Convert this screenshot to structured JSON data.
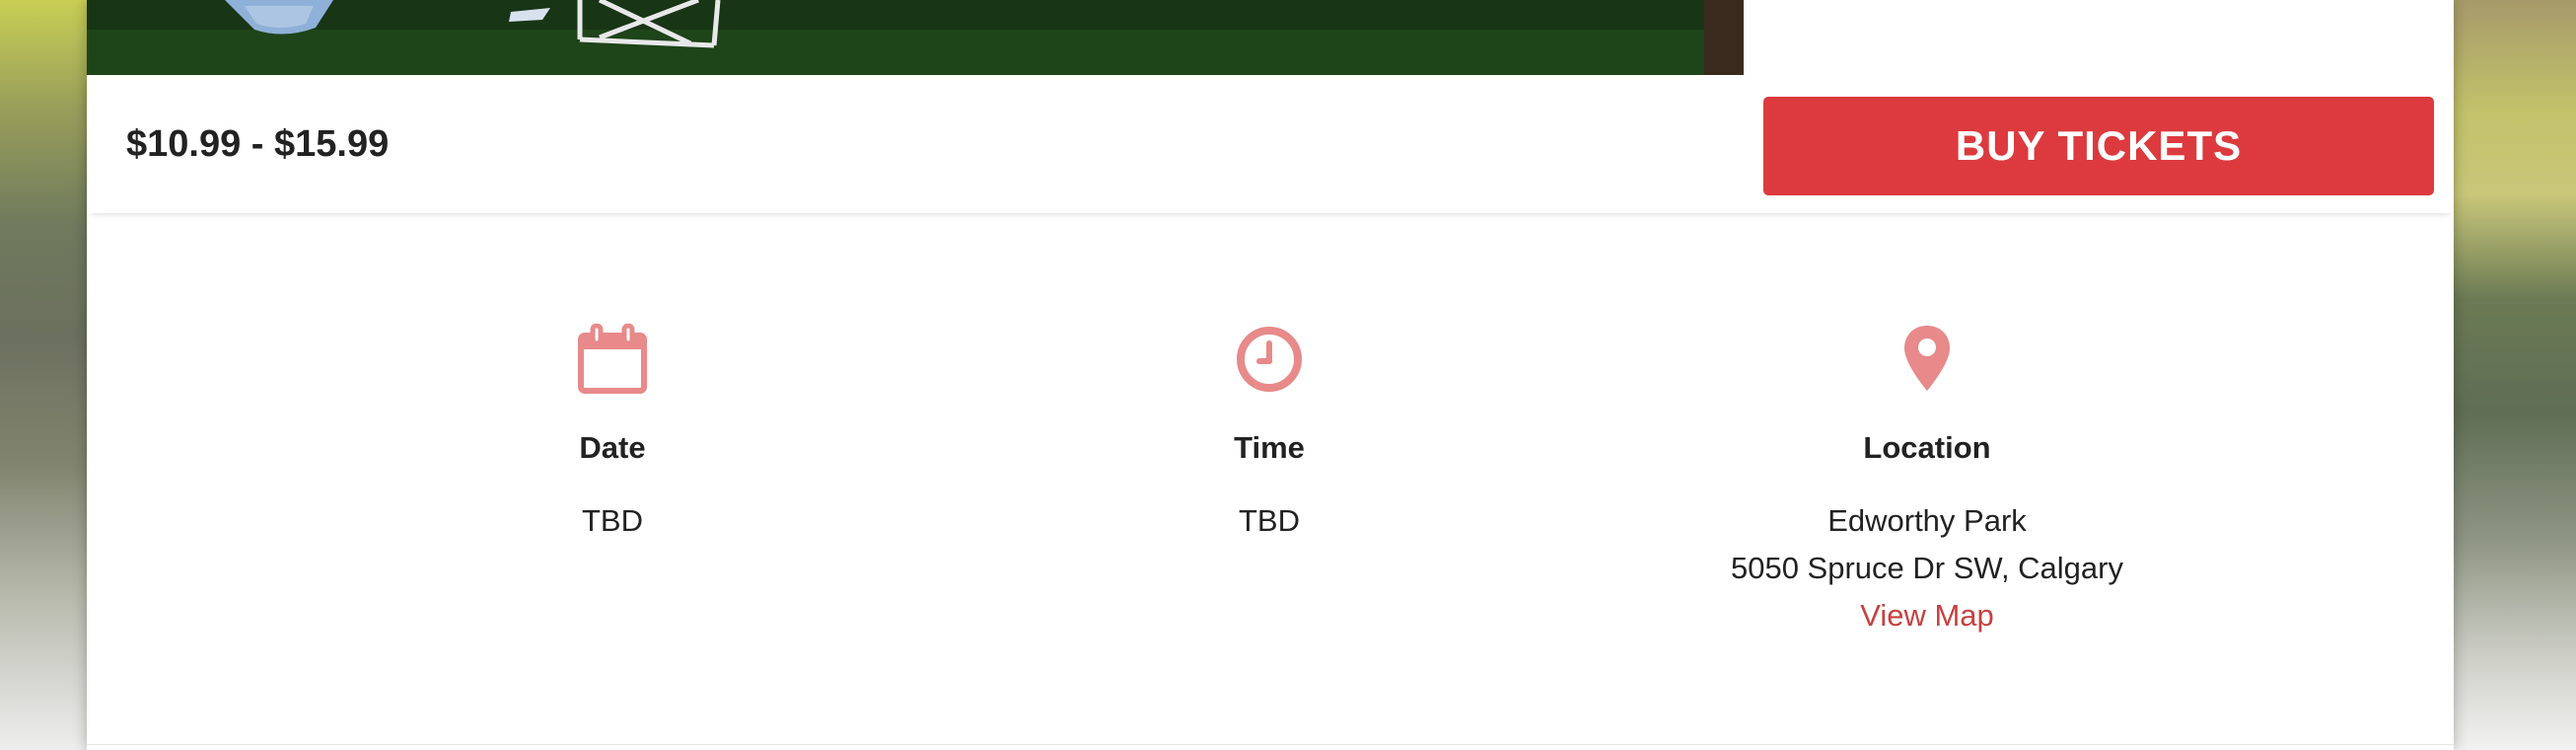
{
  "event": {
    "price_range": "$10.99 - $15.99",
    "buy_label": "BUY TICKETS"
  },
  "details": {
    "date": {
      "icon": "calendar-icon",
      "label": "Date",
      "value": "TBD"
    },
    "time": {
      "icon": "clock-icon",
      "label": "Time",
      "value": "TBD"
    },
    "location": {
      "icon": "map-pin-icon",
      "label": "Location",
      "venue": "Edworthy Park",
      "address": "5050 Spruce Dr SW, Calgary",
      "map_link": "View Map"
    }
  },
  "colors": {
    "accent": "#dc3a3e",
    "icon": "#e8898a",
    "link": "#c8403f"
  }
}
